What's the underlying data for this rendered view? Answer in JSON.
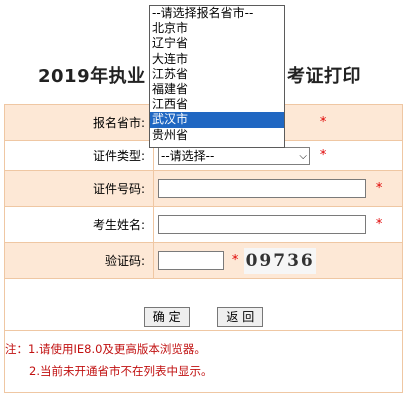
{
  "page": {
    "title_left": "2019年执业",
    "title_right": "考证打印"
  },
  "form": {
    "province_label": "报名省市:",
    "id_type_label": "证件类型:",
    "id_type_value": "--请选择--",
    "id_number_label": "证件号码:",
    "name_label": "考生姓名:",
    "captcha_label": "验证码:",
    "captcha_text": "09736",
    "required_mark": "*"
  },
  "buttons": {
    "confirm": "确 定",
    "back": "返 回"
  },
  "notes": {
    "line1": "注：1.请使用IE8.0及更高版本浏览器。",
    "line2": "2.当前未开通省市不在列表中显示。"
  },
  "dropdown": {
    "options": [
      {
        "label": "--请选择报名省市--",
        "selected": false
      },
      {
        "label": "北京市",
        "selected": false
      },
      {
        "label": "辽宁省",
        "selected": false
      },
      {
        "label": "大连市",
        "selected": false
      },
      {
        "label": "江苏省",
        "selected": false
      },
      {
        "label": "福建省",
        "selected": false
      },
      {
        "label": "江西省",
        "selected": false
      },
      {
        "label": "武汉市",
        "selected": true
      },
      {
        "label": "贵州省",
        "selected": false
      }
    ],
    "highlight_color": "#2067c2"
  },
  "colors": {
    "row_bg": "#fde8d6",
    "border": "#efc7a3",
    "required": "#e00000",
    "note": "#c11111"
  }
}
